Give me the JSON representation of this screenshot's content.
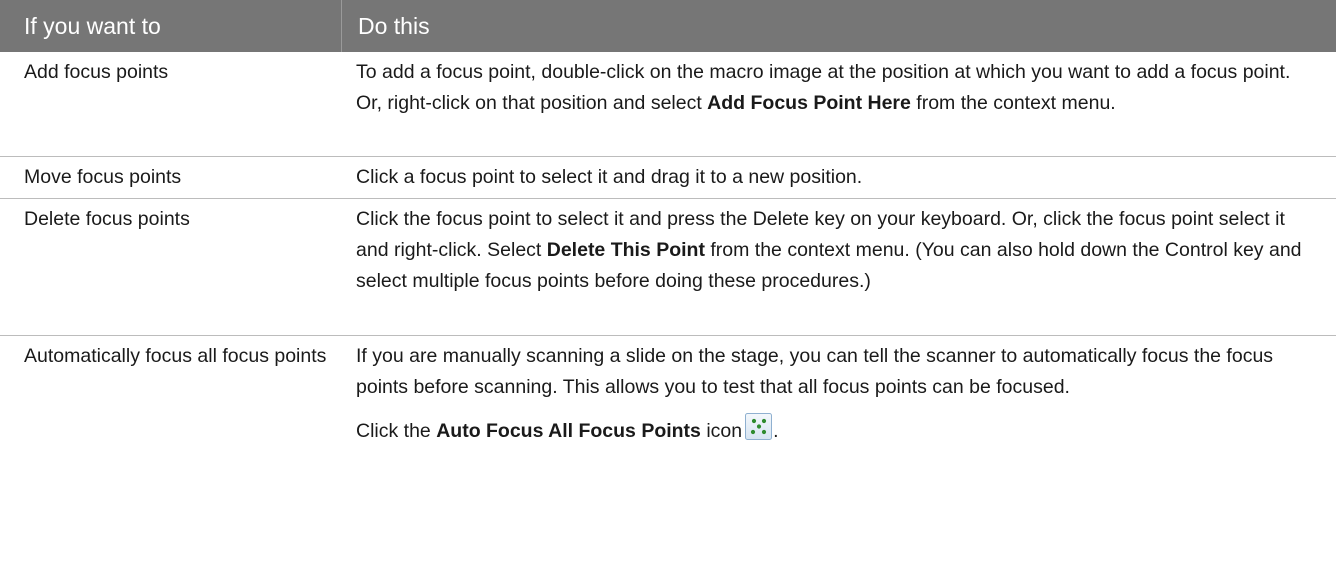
{
  "table": {
    "headers": [
      "If you want to",
      "Do this"
    ],
    "rows": [
      {
        "action": "Add focus points",
        "desc": {
          "pre": "To add a focus point, double-click on the macro image at the position at which you want to add a focus point. Or, right-click on that position and select ",
          "bold": "Add Focus Point Here",
          "post": " from the context menu."
        }
      },
      {
        "action": "Move focus points",
        "desc": {
          "text": "Click a focus point to select it and drag it to a new position."
        }
      },
      {
        "action": "Delete focus points",
        "desc": {
          "pre": "Click the focus point to select it and press the Delete key on your keyboard. Or, click the focus point select it and right-click. Select ",
          "bold": "Delete This Point",
          "post": " from the context menu. (You can also hold down the Control key and select multiple focus points before doing these procedures.)"
        }
      },
      {
        "action": "Automatically focus all focus points",
        "desc": {
          "p1": "If you are manually scanning a slide on the stage, you can tell the scanner to automatically focus the focus points before scanning. This allows you to test that all focus points can be focused.",
          "p2_pre": "Click the ",
          "p2_bold": "Auto Focus All Focus Points",
          "p2_post": " icon",
          "p2_end": "."
        }
      }
    ]
  },
  "colors": {
    "header_bg": "#767676",
    "header_text": "#ffffff",
    "row_divider": "#bcbcbc",
    "icon_dots": "#2e8b2e"
  },
  "icons": {
    "auto_focus": "auto-focus-all-icon"
  }
}
